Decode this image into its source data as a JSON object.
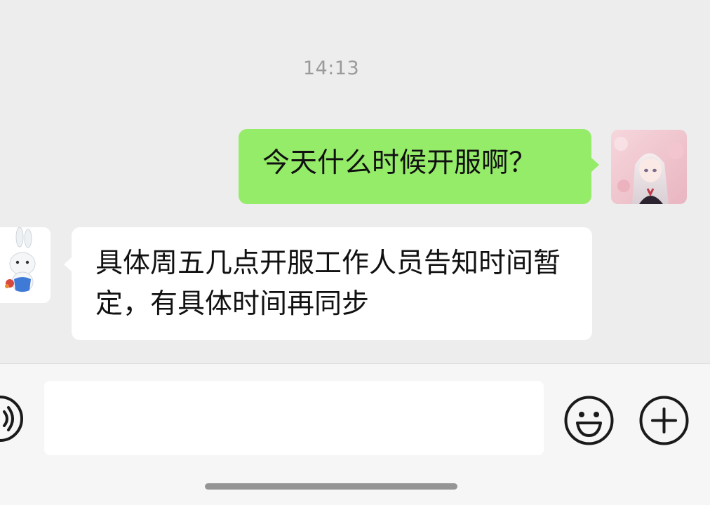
{
  "chat": {
    "timestamp": "14:13",
    "messages": [
      {
        "direction": "outgoing",
        "text": "今天什么时候开服啊？"
      },
      {
        "direction": "incoming",
        "text": "具体周五几点开服工作人员告知时间暂定，有具体时间再同步"
      }
    ]
  },
  "input_bar": {
    "value": "",
    "placeholder": "",
    "voice_icon": "voice-icon",
    "emoji_icon": "smiley-icon",
    "more_icon": "plus-circle-icon"
  },
  "colors": {
    "background": "#ededed",
    "outgoing_bubble": "#95ec69",
    "incoming_bubble": "#ffffff",
    "timestamp_text": "#9a9a9a",
    "icon_stroke": "#1a1a1a"
  }
}
